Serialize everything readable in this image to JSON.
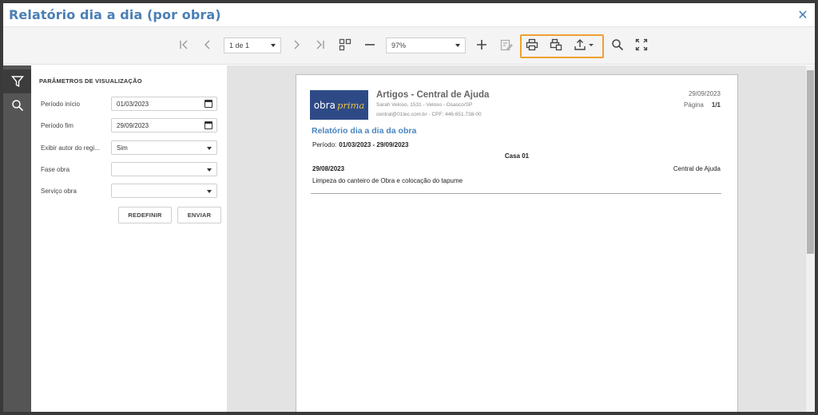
{
  "window": {
    "title": "Relatório dia a dia (por obra)",
    "close_glyph": "✕"
  },
  "toolbar": {
    "page_selector": "1 de 1",
    "zoom": "97%",
    "icons": [
      "first-page-icon",
      "prev-page-icon",
      "next-page-icon",
      "last-page-icon",
      "multipage-icon",
      "zoom-out-icon",
      "zoom-in-icon",
      "edit-params-icon",
      "print-icon",
      "print-preview-icon",
      "export-icon",
      "search-icon",
      "fullscreen-icon"
    ],
    "highlight_color": "#f0a030"
  },
  "sidebar": {
    "icons": [
      "filter-icon",
      "search-icon"
    ]
  },
  "params": {
    "title": "PARÂMETROS DE VISUALIZAÇÃO",
    "fields": [
      {
        "label": "Período início",
        "value": "01/03/2023"
      },
      {
        "label": "Período fim",
        "value": "29/09/2023"
      },
      {
        "label": "Exibir autor do regi...",
        "value": "Sim"
      },
      {
        "label": "Fase obra",
        "value": ""
      },
      {
        "label": "Serviço obra",
        "value": ""
      }
    ],
    "reset_label": "REDEFINIR",
    "submit_label": "ENVIAR"
  },
  "report": {
    "logo_left": "obra",
    "logo_right": "prima",
    "company": "Artigos - Central de Ajuda",
    "address": "Sarah Veloso, 1531 - Veloso - Osasco/SP",
    "contact": "central@01tec.com.br - CPF: 446.651.738-00",
    "date": "29/09/2023",
    "page_label": "Página",
    "page_value": "1/1",
    "title": "Relatório dia a dia da obra",
    "period_label": "Período:",
    "period_value": "01/03/2023 -  29/09/2023",
    "group": "Casa 01",
    "entry_date": "29/08/2023",
    "entry_author": "Central de Ajuda",
    "entry_desc": "Limpeza do canteiro de Obra e colocação do tapume"
  },
  "colors": {
    "title": "#4a7fb5",
    "accent": "#f0a030",
    "report_title": "#4a86c0",
    "logo_bg": "#2e4a86"
  }
}
